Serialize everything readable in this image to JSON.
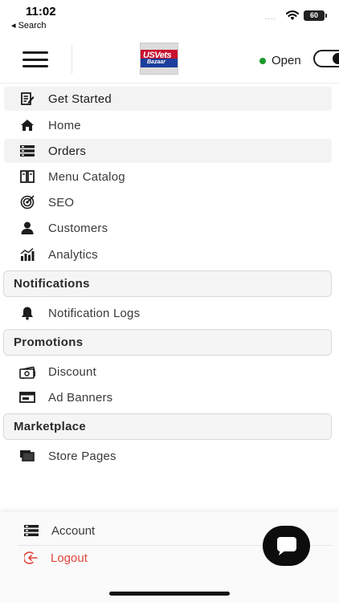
{
  "status_bar": {
    "time": "11:02",
    "back_label": "◂ Search",
    "signal": "....",
    "battery": "60"
  },
  "header": {
    "logo": {
      "text": "USVets",
      "sub_text": "Bazaar",
      "colors": {
        "red": "#c8102e",
        "blue": "#1b3f9c"
      }
    },
    "store_status": "Open",
    "status_color": "#1a9b2c",
    "toggle_on": true
  },
  "menu": {
    "items": [
      {
        "label": "Get Started",
        "icon": "edit-document-icon",
        "active": true
      },
      {
        "label": "Home",
        "icon": "home-icon",
        "active": false
      },
      {
        "label": "Orders",
        "icon": "orders-list-icon",
        "active": true
      },
      {
        "label": "Menu Catalog",
        "icon": "book-icon",
        "active": false
      },
      {
        "label": "SEO",
        "icon": "target-icon",
        "active": false
      },
      {
        "label": "Customers",
        "icon": "user-icon",
        "active": false
      },
      {
        "label": "Analytics",
        "icon": "bar-chart-icon",
        "active": false
      }
    ],
    "sections": [
      {
        "title": "Notifications",
        "items": [
          {
            "label": "Notification Logs",
            "icon": "bell-icon"
          }
        ]
      },
      {
        "title": "Promotions",
        "items": [
          {
            "label": "Discount",
            "icon": "money-icon"
          },
          {
            "label": "Ad Banners",
            "icon": "banner-icon"
          }
        ]
      },
      {
        "title": "Marketplace",
        "items": [
          {
            "label": "Store Pages",
            "icon": "pages-icon"
          }
        ]
      }
    ]
  },
  "bottom": {
    "account_label": "Account",
    "logout_label": "Logout",
    "logout_color": "#e0453a"
  },
  "chat": {
    "icon": "chat-bubble-icon"
  }
}
